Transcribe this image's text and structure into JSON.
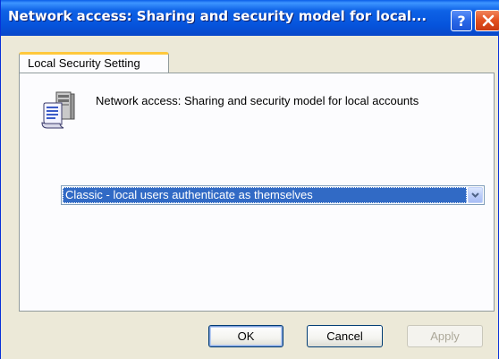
{
  "window": {
    "title": "Network access: Sharing and security model for local...",
    "help_glyph": "?",
    "close_glyph": "×"
  },
  "tabs": [
    {
      "label": "Local Security Setting",
      "selected": true
    }
  ],
  "policy": {
    "icon": "policy-document-icon",
    "name": "Network access: Sharing and security model for local accounts"
  },
  "setting": {
    "selected_value": "Classic - local users authenticate as themselves"
  },
  "buttons": {
    "ok": "OK",
    "cancel": "Cancel",
    "apply": "Apply"
  },
  "colors": {
    "titlebar": "#0654dc",
    "selection": "#316ac5",
    "dialog_bg": "#ece9d8",
    "tab_highlight": "#ffc83c"
  }
}
